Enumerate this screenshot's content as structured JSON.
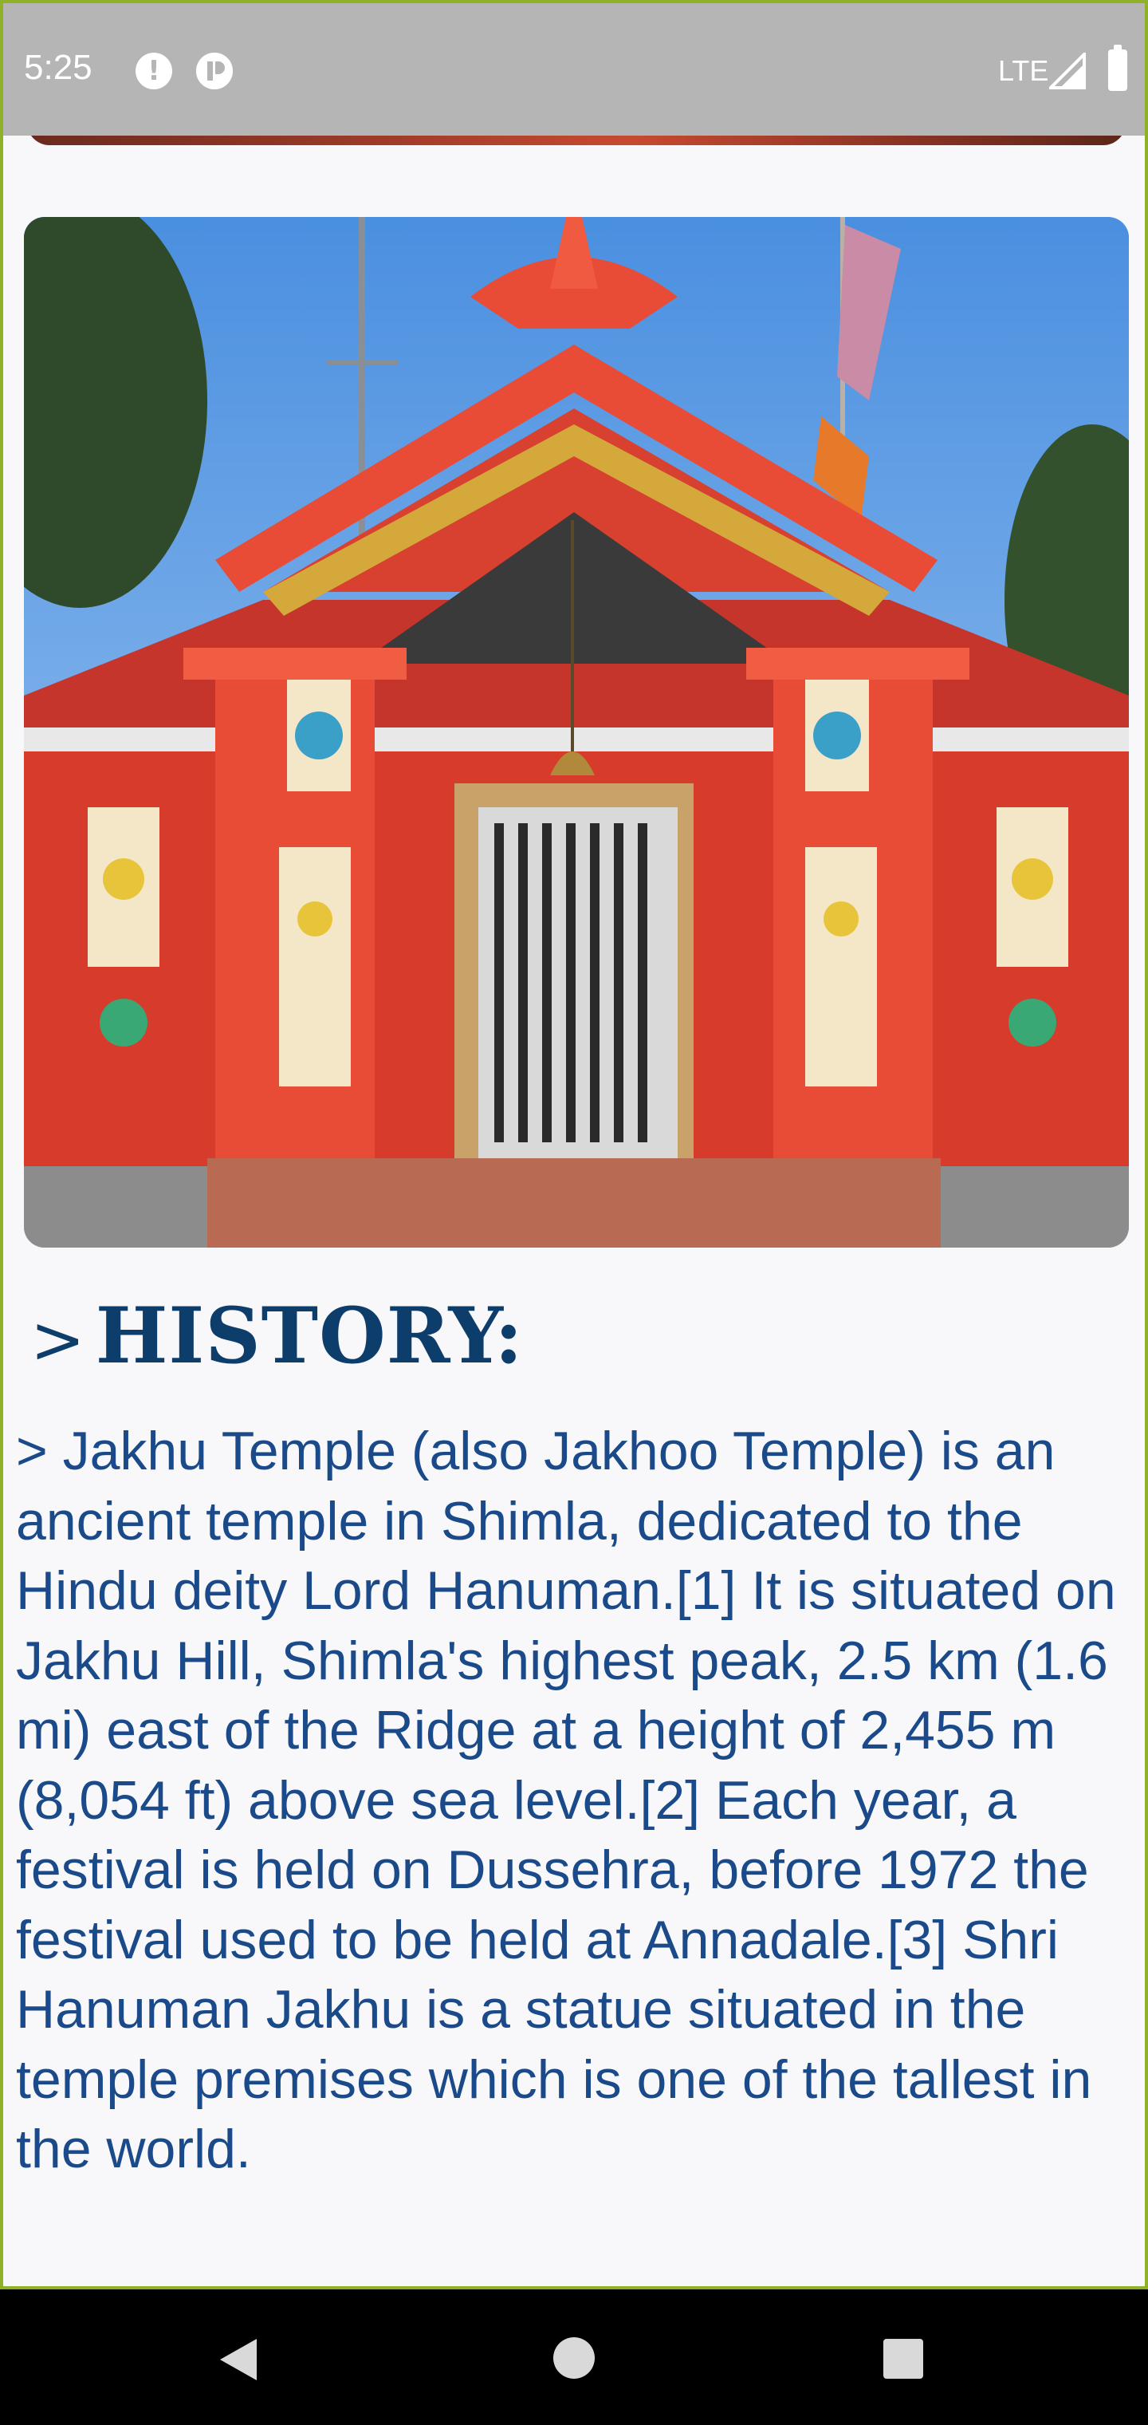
{
  "status_bar": {
    "time": "5:25",
    "network": "LTE",
    "icons": [
      "alert-icon",
      "vpn-icon",
      "signal-icon",
      "battery-icon"
    ]
  },
  "image": {
    "subject": "Jakhu Temple red painted facade"
  },
  "history": {
    "arrow": ">",
    "heading": "HISTORY:",
    "text": " > Jakhu Temple (also Jakhoo Temple) is an ancient temple in Shimla, dedicated to the Hindu deity Lord Hanuman.[1] It is situated on Jakhu Hill, Shimla's highest peak, 2.5 km (1.6 mi) east of the Ridge at a height of 2,455 m (8,054 ft) above sea level.[2] Each year, a festival is held on Dussehra, before 1972 the festival used to be held at Annadale.[3] Shri Hanuman Jakhu is a statue situated in the temple premises which is one of the tallest in the world."
  },
  "nav_bar": {
    "buttons": [
      "back-icon",
      "home-icon",
      "recents-icon"
    ]
  },
  "colors": {
    "heading": "#0d3d6b",
    "body_text": "#1b4a8a",
    "status_bar": "#b5b5b5",
    "frame_border": "#8fb128",
    "background": "#f8f8fa"
  }
}
